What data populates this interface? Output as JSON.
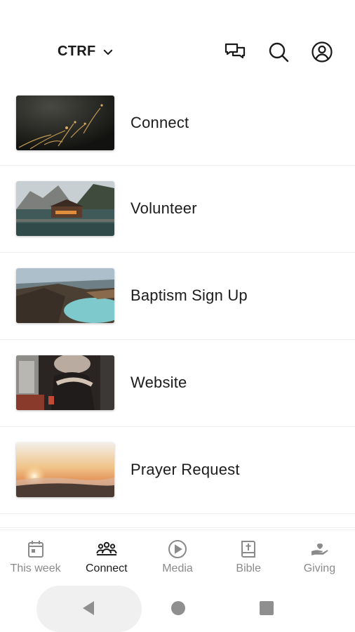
{
  "header": {
    "org_name": "CTRF",
    "icons": [
      "chat-icon",
      "search-icon",
      "account-icon"
    ]
  },
  "list": {
    "items": [
      {
        "label": "Connect",
        "thumb": "dark-grass-photo"
      },
      {
        "label": "Volunteer",
        "thumb": "lake-cabin-photo"
      },
      {
        "label": "Baptism Sign Up",
        "thumb": "crater-lake-photo"
      },
      {
        "label": "Website",
        "thumb": "person-reading-photo"
      },
      {
        "label": "Prayer Request",
        "thumb": "sunset-clouds-photo"
      }
    ]
  },
  "bottom_nav": {
    "active": "Connect",
    "items": [
      {
        "label": "This week",
        "icon": "calendar-icon"
      },
      {
        "label": "Connect",
        "icon": "people-icon"
      },
      {
        "label": "Media",
        "icon": "play-circle-icon"
      },
      {
        "label": "Bible",
        "icon": "bible-icon"
      },
      {
        "label": "Giving",
        "icon": "giving-hand-icon"
      }
    ]
  },
  "colors": {
    "text_primary": "#1c1c1c",
    "nav_inactive": "#8a8a8a",
    "divider": "#eeeeee"
  }
}
